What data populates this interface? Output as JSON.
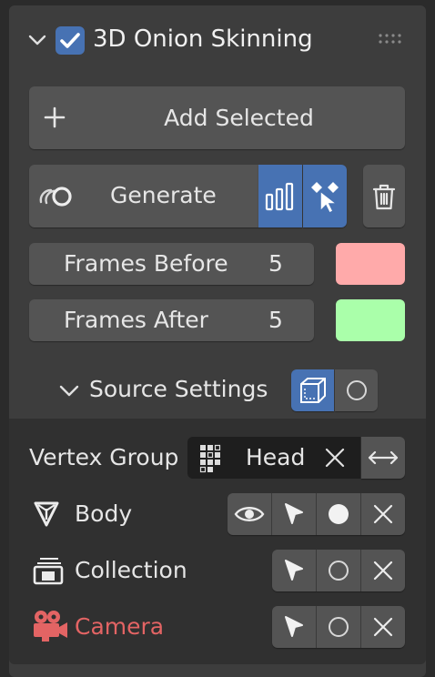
{
  "panel": {
    "title": "3D Onion Skinning",
    "enabled": true
  },
  "actions": {
    "add_selected_label": "Add Selected",
    "generate_label": "Generate"
  },
  "frames_before": {
    "label": "Frames Before",
    "value": "5",
    "color": "#ffaaaa"
  },
  "frames_after": {
    "label": "Frames After",
    "value": "5",
    "color": "#aaffaa"
  },
  "source_settings": {
    "label": "Source Settings",
    "vertex_group_label": "Vertex Group",
    "vertex_group_value": "Head",
    "rows": [
      {
        "name": "Body",
        "color": "#e6e6e6"
      },
      {
        "name": "Collection",
        "color": "#e6e6e6"
      },
      {
        "name": "Camera",
        "color": "#e36464"
      }
    ]
  },
  "colors": {
    "accent": "#4772b3",
    "button": "#545454",
    "panel": "#3d3d3d"
  }
}
